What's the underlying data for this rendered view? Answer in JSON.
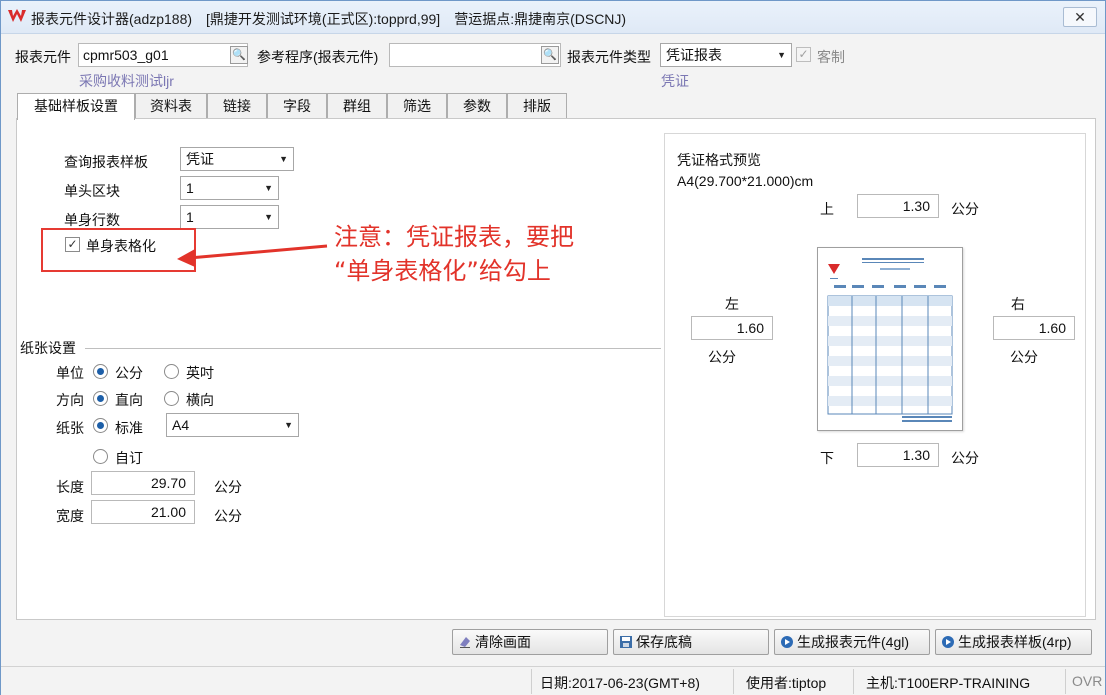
{
  "window": {
    "title": "报表元件设计器(adzp188)　[鼎捷开发测试环境(正式区):topprd,99]　营运据点:鼎捷南京(DSCNJ)",
    "close_label": "✕"
  },
  "header": {
    "report_element_label": "报表元件",
    "report_element_value": "cpmr503_g01",
    "report_element_desc": "采购收料测试ljr",
    "ref_program_label": "参考程序(报表元件)",
    "ref_program_value": "",
    "element_type_label": "报表元件类型",
    "element_type_value": "凭证报表",
    "element_type_desc": "凭证",
    "custom_label": "客制",
    "custom_checked": true
  },
  "tabs": [
    {
      "label": "基础样板设置",
      "active": true
    },
    {
      "label": "资料表"
    },
    {
      "label": "链接"
    },
    {
      "label": "字段"
    },
    {
      "label": "群组"
    },
    {
      "label": "筛选"
    },
    {
      "label": "参数"
    },
    {
      "label": "排版"
    }
  ],
  "basic": {
    "query_template_label": "查询报表样板",
    "query_template_value": "凭证",
    "header_block_label": "单头区块",
    "header_block_value": "1",
    "body_rows_label": "单身行数",
    "body_rows_value": "1",
    "body_table_label": "单身表格化",
    "body_table_checked": true
  },
  "annotation": {
    "line1": "注意：凭证报表，要把",
    "line2": "“单身表格化”给勾上",
    "color": "#e2332a"
  },
  "paper": {
    "section_title": "纸张设置",
    "unit_label": "单位",
    "unit_options": [
      "公分",
      "英吋"
    ],
    "direction_label": "方向",
    "direction_options": [
      "直向",
      "横向"
    ],
    "paper_label": "纸张",
    "paper_standard_label": "标准",
    "paper_size_value": "A4",
    "paper_custom_label": "自订",
    "length_label": "长度",
    "length_value": "29.70",
    "width_label": "宽度",
    "width_value": "21.00",
    "unit_text": "公分"
  },
  "preview": {
    "title": "凭证格式预览",
    "size_text": "A4(29.700*21.000)cm",
    "top_label": "上",
    "top_value": "1.30",
    "bottom_label": "下",
    "bottom_value": "1.30",
    "left_label": "左",
    "left_value": "1.60",
    "right_label": "右",
    "right_value": "1.60",
    "unit_text": "公分"
  },
  "buttons": {
    "clear": "清除画面",
    "save_draft": "保存底稿",
    "gen_element": "生成报表元件(4gl)",
    "gen_template": "生成报表样板(4rp)"
  },
  "status": {
    "date": "日期:2017-06-23(GMT+8)",
    "user": "使用者:tiptop",
    "host": "主机:T100ERP-TRAINING",
    "mode": "OVR"
  }
}
